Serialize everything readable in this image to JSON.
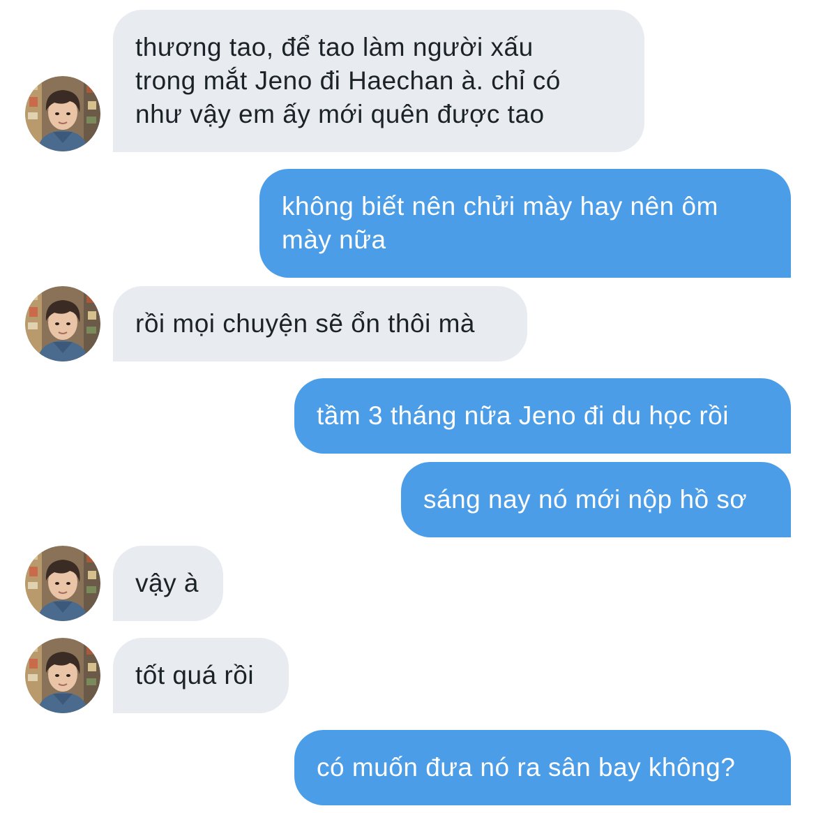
{
  "conversation": {
    "messages": [
      {
        "id": "m1",
        "direction": "incoming",
        "text": "thương tao, để tao làm người xấu\ntrong mắt Jeno đi Haechan à. chỉ có\nnhư vậy em ấy mới quên được tao"
      },
      {
        "id": "m2",
        "direction": "outgoing",
        "text": "không biết nên chửi mày hay nên ôm\nmày nữa"
      },
      {
        "id": "m3",
        "direction": "incoming",
        "text": "rồi mọi chuyện sẽ ổn thôi mà"
      },
      {
        "id": "m4",
        "direction": "outgoing",
        "text": "tầm 3 tháng nữa Jeno đi du học rồi"
      },
      {
        "id": "m5",
        "direction": "outgoing",
        "text": "sáng nay nó mới nộp hồ sơ"
      },
      {
        "id": "m6",
        "direction": "incoming",
        "text": "vậy à"
      },
      {
        "id": "m7",
        "direction": "incoming",
        "text": "tốt quá rồi"
      },
      {
        "id": "m8",
        "direction": "outgoing",
        "text": "có muốn đưa nó ra sân bay không?"
      }
    ]
  },
  "theme": {
    "incoming_bubble": "#e8ecf0",
    "incoming_text": "#1b2228",
    "outgoing_bubble": "#4c9de8",
    "outgoing_text": "#ffffff"
  }
}
